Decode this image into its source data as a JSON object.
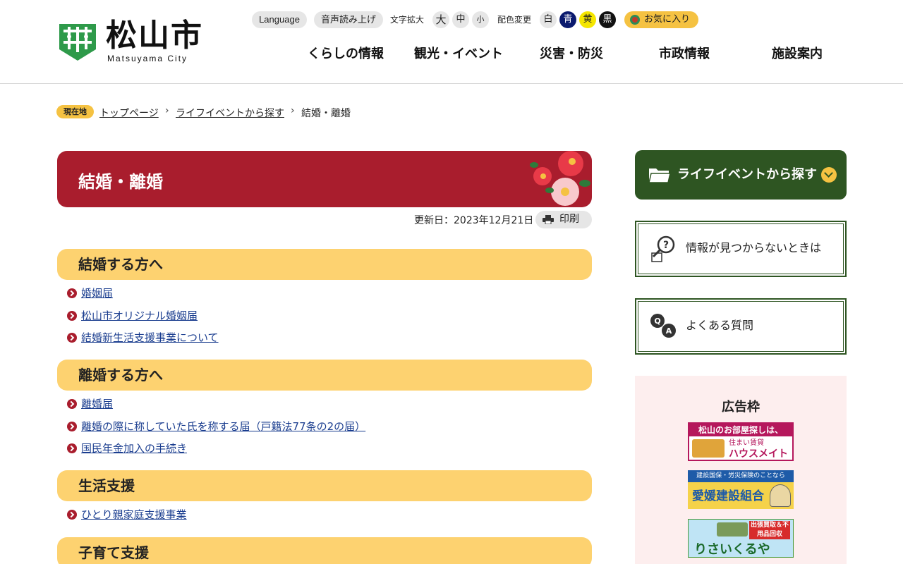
{
  "header": {
    "logo_title": "松山市",
    "logo_sub": "Matsuyama City",
    "util": {
      "language": "Language",
      "read_aloud": "音声読み上げ",
      "text_size_label": "文字拡大",
      "size_large": "大",
      "size_medium": "中",
      "size_small": "小",
      "color_label": "配色変更",
      "color_white": "白",
      "color_blue": "青",
      "color_yellow": "黄",
      "color_black": "黒",
      "favorite": "お気に入り"
    },
    "nav": [
      "くらしの情報",
      "観光・イベント",
      "災害・防災",
      "市政情報",
      "施設案内"
    ]
  },
  "breadcrumb": {
    "badge": "現在地",
    "items": [
      "トップページ",
      "ライフイベントから探す"
    ],
    "current": "結婚・離婚"
  },
  "main": {
    "title": "結婚・離婚",
    "updated": "更新日：2023年12月21日",
    "print": "印刷",
    "sections": [
      {
        "heading": "結婚する方へ",
        "links": [
          "婚姻届",
          "松山市オリジナル婚姻届",
          "結婚新生活支援事業について"
        ]
      },
      {
        "heading": "離婚する方へ",
        "links": [
          "離婚届",
          "離婚の際に称していた氏を称する届（戸籍法77条の2の届）",
          "国民年金加入の手続き"
        ]
      },
      {
        "heading": "生活支援",
        "links": [
          "ひとり親家庭支援事業"
        ]
      },
      {
        "heading": "子育て支援",
        "links": []
      }
    ]
  },
  "sidebar": {
    "life_event": "ライフイベントから探す",
    "not_found": "情報が見つからないときは",
    "faq": "よくある質問",
    "ad_title": "広告枠",
    "ads": {
      "ad1_top": "松山のお部屋探しは、",
      "ad1_sub": "住まい賃貸",
      "ad1_main": "ハウスメイト",
      "ad2_top": "建設国保・労災保険のことなら",
      "ad2_main": "愛媛建設組合",
      "ad3_tag": "出張買取＆不用品回収",
      "ad3_main": "りさいくるや"
    }
  },
  "colors": {
    "title_red": "#a91d2d",
    "section_yellow": "#fdd270",
    "sidebar_green": "#2e5522",
    "link_blue": "#1a3d8f",
    "ad_bg": "#fdeeee"
  }
}
